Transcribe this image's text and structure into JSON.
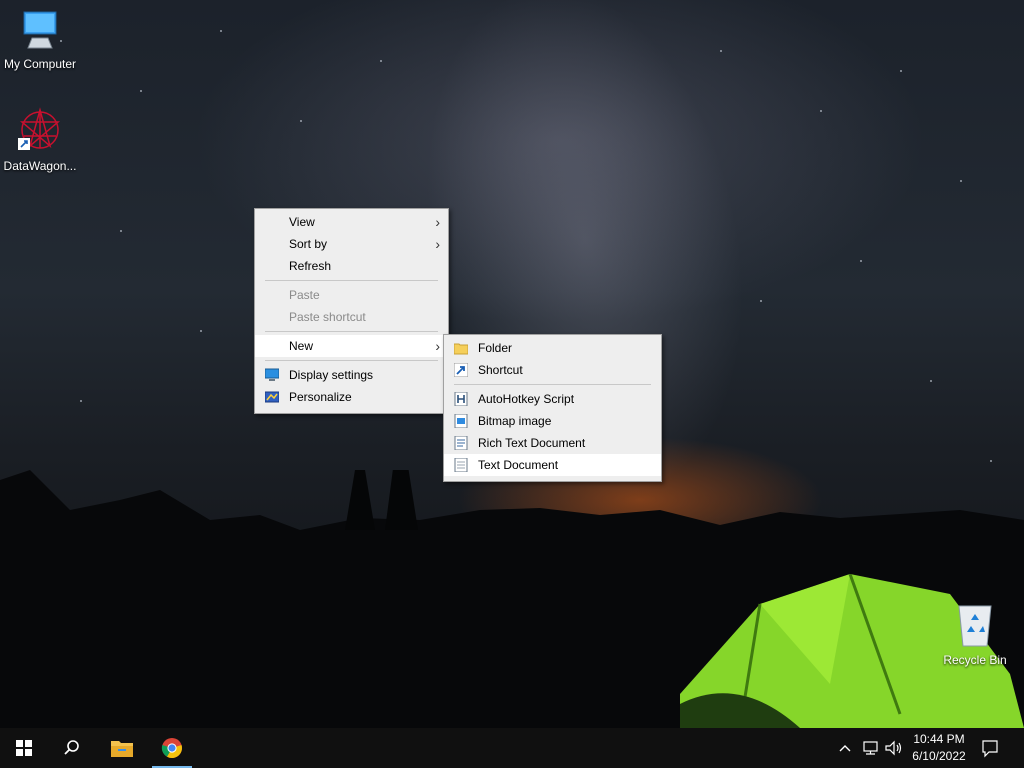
{
  "desktop": {
    "icons": [
      {
        "label": "My Computer",
        "icon": "computer-icon"
      },
      {
        "label": "DataWagon...",
        "icon": "datawagon-icon"
      },
      {
        "label": "Recycle Bin",
        "icon": "recycle-bin-icon"
      }
    ]
  },
  "context_menu": {
    "view": "View",
    "sort_by": "Sort by",
    "refresh": "Refresh",
    "paste": "Paste",
    "paste_shortcut": "Paste shortcut",
    "new": "New",
    "display_settings": "Display settings",
    "personalize": "Personalize"
  },
  "new_submenu": {
    "folder": "Folder",
    "shortcut": "Shortcut",
    "autohotkey": "AutoHotkey Script",
    "bitmap": "Bitmap image",
    "rtf": "Rich Text Document",
    "text": "Text Document"
  },
  "taskbar": {
    "time": "10:44 PM",
    "date": "6/10/2022",
    "pinned": [
      "file-explorer-icon",
      "chrome-icon"
    ]
  },
  "colors": {
    "taskbar": "#101010",
    "menu": "#eeeeee",
    "accent": "#76b9ed"
  }
}
